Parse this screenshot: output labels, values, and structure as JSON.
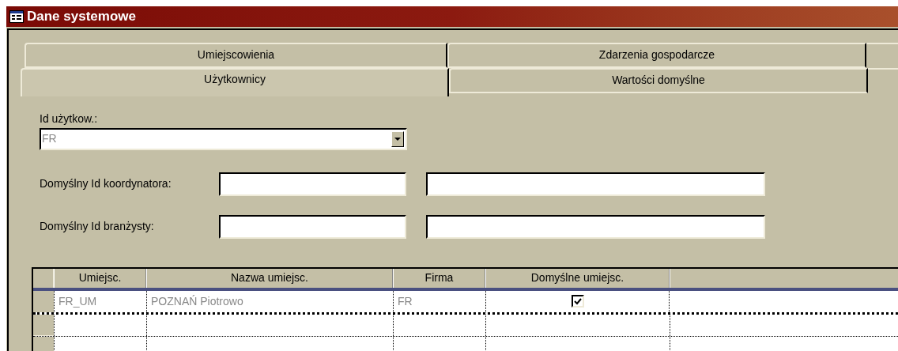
{
  "window": {
    "title": "Dane systemowe"
  },
  "tab_rows": [
    [
      {
        "label": "Umiejscowienia",
        "selected": false
      },
      {
        "label": "Zdarzenia gospodarcze",
        "selected": false
      }
    ],
    [
      {
        "label": "Użytkownicy",
        "selected": true
      },
      {
        "label": "Wartości domyślne",
        "selected": false
      }
    ]
  ],
  "user_id": {
    "label": "Id użytkow.:",
    "value": "FR"
  },
  "fields": [
    {
      "label": "Domyślny Id koordynatora:"
    },
    {
      "label": "Domyślny Id branżysty:"
    }
  ],
  "table": {
    "columns": [
      "Umiejsc.",
      "Nazwa umiejsc.",
      "Firma",
      "Domyślne umiejsc."
    ],
    "rows": [
      {
        "cells": [
          "FR_UM",
          "POZNAŃ Piotrowo",
          "FR"
        ],
        "default_checked": true
      }
    ]
  }
}
